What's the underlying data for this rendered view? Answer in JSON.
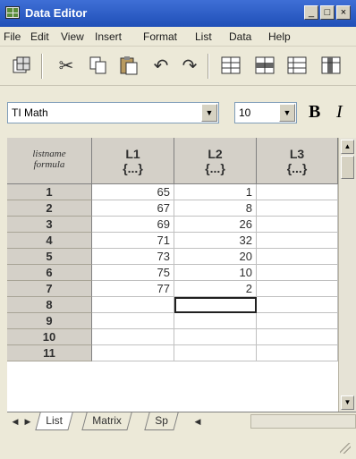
{
  "window": {
    "title": "Data Editor",
    "minimize": "_",
    "maximize": "□",
    "close": "×"
  },
  "menu": [
    "File",
    "Edit",
    "View",
    "Insert",
    "Format",
    "List",
    "Data",
    "Help"
  ],
  "toolbar": {
    "icons": [
      "editor-icon",
      "cut-icon",
      "copy-icon",
      "paste-icon",
      "undo-icon",
      "redo-icon",
      "insert-cells-icon",
      "insert-rows-icon",
      "insert-columns-icon"
    ]
  },
  "format_bar": {
    "font": "TI Math",
    "size": "10",
    "bold": "B",
    "italic": "I"
  },
  "grid": {
    "corner": {
      "line1": "listname",
      "line2": "formula"
    },
    "columns": [
      {
        "name": "L1",
        "formula": "{...}"
      },
      {
        "name": "L2",
        "formula": "{...}"
      },
      {
        "name": "L3",
        "formula": "{...}"
      }
    ],
    "rows": [
      {
        "n": "1",
        "L1": "65",
        "L2": "1",
        "L3": ""
      },
      {
        "n": "2",
        "L1": "67",
        "L2": "8",
        "L3": ""
      },
      {
        "n": "3",
        "L1": "69",
        "L2": "26",
        "L3": ""
      },
      {
        "n": "4",
        "L1": "71",
        "L2": "32",
        "L3": ""
      },
      {
        "n": "5",
        "L1": "73",
        "L2": "20",
        "L3": ""
      },
      {
        "n": "6",
        "L1": "75",
        "L2": "10",
        "L3": ""
      },
      {
        "n": "7",
        "L1": "77",
        "L2": "2",
        "L3": ""
      },
      {
        "n": "8",
        "L1": "",
        "L2": "",
        "L3": ""
      },
      {
        "n": "9",
        "L1": "",
        "L2": "",
        "L3": ""
      },
      {
        "n": "10",
        "L1": "",
        "L2": "",
        "L3": ""
      },
      {
        "n": "11",
        "L1": "",
        "L2": "",
        "L3": ""
      }
    ],
    "selected": {
      "row": "8",
      "column": "L2"
    }
  },
  "tabs": [
    {
      "label": "List",
      "active": true
    },
    {
      "label": "Matrix",
      "active": false
    },
    {
      "label": "Sp",
      "active": false
    }
  ]
}
